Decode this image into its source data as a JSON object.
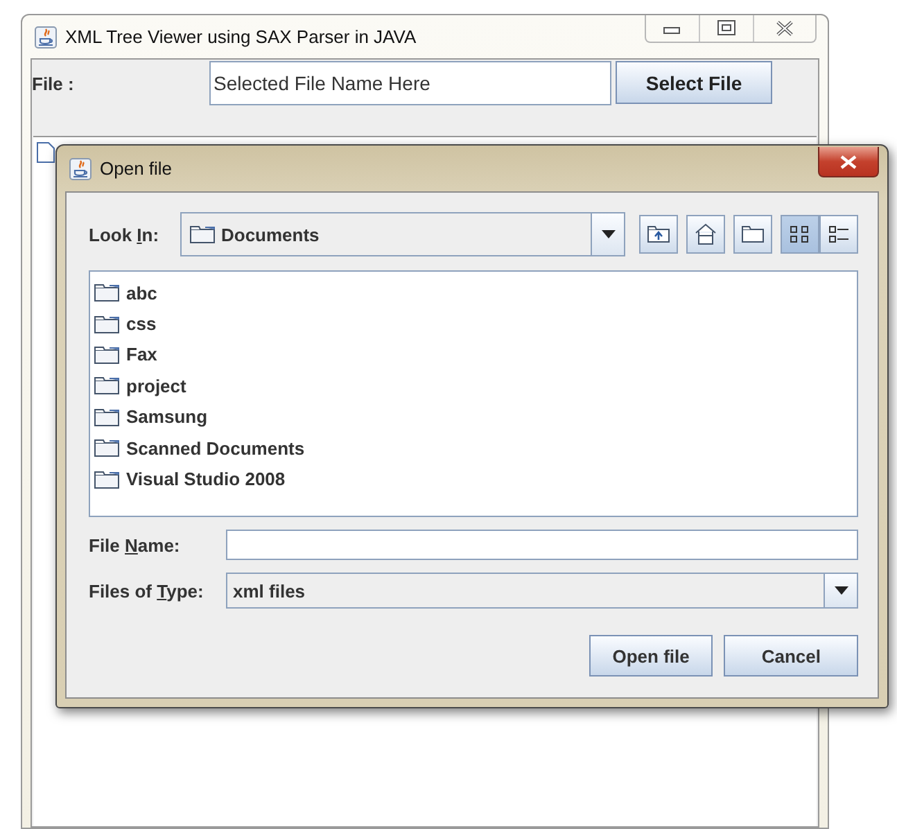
{
  "main_window": {
    "title": "XML Tree Viewer using SAX Parser in JAVA",
    "file_label": "File :",
    "file_field": {
      "value": "Selected File Name Here"
    },
    "select_button": "Select File"
  },
  "dialog": {
    "title": "Open file",
    "look_in": {
      "label": [
        {
          "text": "Look ",
          "underlined": false
        },
        {
          "text": "I",
          "underlined": true
        },
        {
          "text": "n:",
          "underlined": false
        }
      ],
      "value": "Documents"
    },
    "view_modes": [
      {
        "kind": "list",
        "selected": true
      },
      {
        "kind": "details",
        "selected": false
      }
    ],
    "files": [
      "abc",
      "css",
      "Fax",
      "project",
      "Samsung",
      "Scanned Documents",
      "Visual Studio 2008"
    ],
    "file_name": {
      "label": [
        {
          "text": "File ",
          "underlined": false
        },
        {
          "text": "N",
          "underlined": true
        },
        {
          "text": "ame:",
          "underlined": false
        }
      ]
    },
    "files_of_type": {
      "label": [
        {
          "text": "Files of ",
          "underlined": false
        },
        {
          "text": "T",
          "underlined": true
        },
        {
          "text": "ype:",
          "underlined": false
        }
      ],
      "value": "xml files"
    },
    "buttons": [
      "Open file",
      "Cancel"
    ]
  }
}
